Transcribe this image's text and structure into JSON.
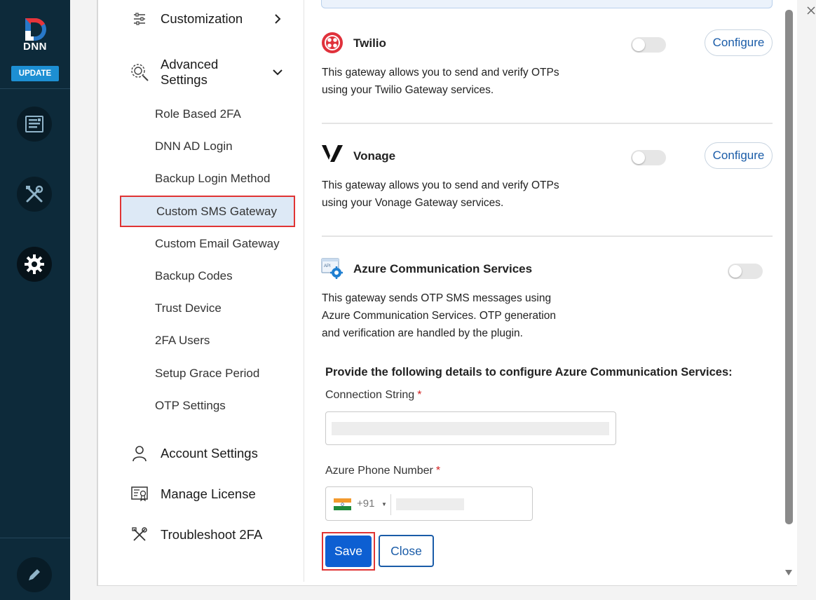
{
  "rail": {
    "logo_text": "DNN",
    "update_label": "UPDATE",
    "icons": [
      "content-icon",
      "tools-icon",
      "settings-gear-icon",
      "edit-pencil-icon"
    ],
    "colors": {
      "background": "#0d2a3a",
      "update": "#1d8fd3"
    }
  },
  "sidebar": {
    "customization": "Customization",
    "advanced_line1": "Advanced",
    "advanced_line2": "Settings",
    "sub_items": [
      "Role Based 2FA",
      "DNN AD Login",
      "Backup Login Method",
      "Custom SMS Gateway",
      "Custom Email Gateway",
      "Backup Codes",
      "Trust Device",
      "2FA Users",
      "Setup Grace Period",
      "OTP Settings"
    ],
    "active_item": "Custom SMS Gateway",
    "account_settings": "Account Settings",
    "manage_license": "Manage License",
    "troubleshoot": "Troubleshoot 2FA"
  },
  "gateways": {
    "twilio": {
      "title": "Twilio",
      "desc_line1": "This gateway allows you to send and verify OTPs",
      "desc_line2": "using your Twilio Gateway services.",
      "enabled": false,
      "configure": "Configure"
    },
    "vonage": {
      "title": "Vonage",
      "desc_line1": "This gateway allows you to send and verify OTPs",
      "desc_line2": "using your Vonage Gateway services.",
      "enabled": false,
      "configure": "Configure"
    },
    "azure": {
      "title": "Azure Communication Services",
      "desc_line1": "This gateway sends OTP SMS messages using",
      "desc_line2": "Azure Communication Services. OTP generation",
      "desc_line3": "and verification are handled by the plugin.",
      "enabled": false,
      "icon_badge": "API"
    }
  },
  "form": {
    "heading": "Provide the following details to configure Azure Communication Services:",
    "connection_label": "Connection String",
    "phone_label": "Azure Phone Number",
    "required_mark": "*",
    "country_code": "+91",
    "save": "Save",
    "close": "Close"
  },
  "colors": {
    "accent": "#0d5fd2",
    "link": "#1a5ca8",
    "highlight": "#e03434",
    "active_bg": "#dde9f6",
    "twilio": "#e0313b"
  }
}
